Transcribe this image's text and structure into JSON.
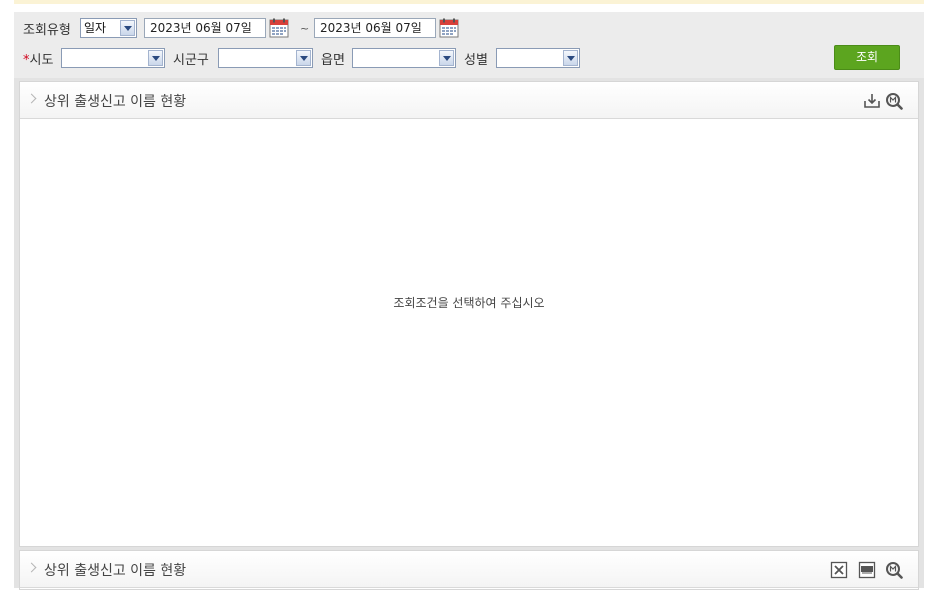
{
  "filters": {
    "query_type_label": "조회유형",
    "query_type_value": "일자",
    "date_from": "2023년 06월 07일",
    "date_separator": "~",
    "date_to": "2023년 06월 07일",
    "sido_required_mark": "*",
    "sido_label": "시도",
    "sido_value": "",
    "sigungu_label": "시군구",
    "sigungu_value": "",
    "eupmyeon_label": "읍면",
    "eupmyeon_value": "",
    "gender_label": "성별",
    "gender_value": "",
    "search_button": "조회"
  },
  "panels": [
    {
      "title": "상위 출생신고 이름 현황",
      "empty_message": "조회조건을 선택하여 주십시오"
    },
    {
      "title": "상위 출생신고 이름 현황"
    }
  ],
  "icons": {
    "panel1": [
      "download-icon",
      "zoom-icon"
    ],
    "panel2": [
      "excel-icon",
      "pdf-icon",
      "zoom-icon"
    ]
  },
  "colors": {
    "search_button": "#5ca51f",
    "filter_background": "#ececec",
    "required_mark": "#d0021b"
  }
}
